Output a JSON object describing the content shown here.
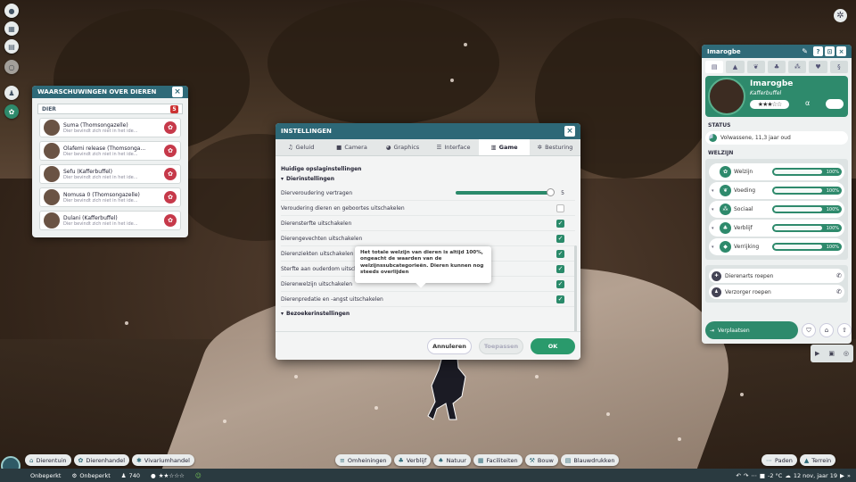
{
  "warnings_panel": {
    "title": "WAARSCHUWINGEN OVER DIEREN",
    "filter_label": "DIER",
    "filter_count": "5",
    "items": [
      {
        "name": "Suma (Thomsongazelle)",
        "message": "Dier bevindt zich niet in het ide..."
      },
      {
        "name": "Olafemi release (Thomsonga...",
        "message": "Dier bevindt zich niet in het ide..."
      },
      {
        "name": "Sefu (Kafferbuffel)",
        "message": "Dier bevindt zich niet in het ide..."
      },
      {
        "name": "Nomusa 0 (Thomsongazelle)",
        "message": "Dier bevindt zich niet in het ide..."
      },
      {
        "name": "Dulani (Kafferbuffel)",
        "message": "Dier bevindt zich niet in het ide..."
      }
    ]
  },
  "settings": {
    "title": "INSTELLINGEN",
    "tabs": [
      {
        "label": "Geluid",
        "icon": "music-icon"
      },
      {
        "label": "Camera",
        "icon": "camera-icon"
      },
      {
        "label": "Graphics",
        "icon": "palette-icon"
      },
      {
        "label": "Interface",
        "icon": "list-icon"
      },
      {
        "label": "Game",
        "icon": "chart-icon"
      },
      {
        "label": "Besturing",
        "icon": "gear-icon"
      }
    ],
    "active_tab": "Game",
    "section_title": "Huidige opslaginstellingen",
    "subsection_animals": "Dierinstellingen",
    "slider_row": {
      "label": "Dierveroudering vertragen",
      "value": "5",
      "fraction": 1.0
    },
    "rows": [
      {
        "label": "Veroudering dieren en geboortes uitschakelen",
        "checked": false
      },
      {
        "label": "Dierensterfte uitschakelen",
        "checked": true
      },
      {
        "label": "Dierengevechten uitschakelen",
        "checked": true
      },
      {
        "label": "Dierenziekten uitschakelen",
        "checked": true
      },
      {
        "label": "Sterfte aan ouderdom uitschakelen",
        "checked": true
      },
      {
        "label": "Dierenwelzijn uitschakelen",
        "checked": true
      },
      {
        "label": "Dierenpredatie en -angst uitschakelen",
        "checked": true
      }
    ],
    "subsection_visitors": "Bezoekerinstellingen",
    "tooltip": "Het totale welzijn van dieren is altijd 100%, ongeacht de waarden van de welzijnssubcategorieën. Dieren kunnen nog steeds overlijden",
    "buttons": {
      "cancel": "Annuleren",
      "apply": "Toepassen",
      "ok": "OK"
    }
  },
  "animal_panel": {
    "title": "Imarogbe",
    "name": "Imarogbe",
    "species": "Kafferbuffel",
    "rating_stars": 3,
    "rating_max": 5,
    "status_header": "STATUS",
    "status_text": "Volwassene, 11,3 jaar oud",
    "welfare_header": "WELZIJN",
    "welfare": [
      {
        "label": "Welzijn",
        "value": "100%",
        "level": 100
      },
      {
        "label": "Voeding",
        "value": "100%",
        "level": 100
      },
      {
        "label": "Sociaal",
        "value": "100%",
        "level": 100
      },
      {
        "label": "Verblijf",
        "value": "100%",
        "level": 100
      },
      {
        "label": "Verrijking",
        "value": "100%",
        "level": 100
      }
    ],
    "calls": [
      {
        "label": "Dierenarts roepen"
      },
      {
        "label": "Verzorger roepen"
      }
    ],
    "move_label": "Verplaatsen"
  },
  "bottom_bar": {
    "left_buttons": [
      "Dierentuin",
      "Dierenhandel",
      "Vivariumhandel"
    ],
    "center_buttons": [
      "Omheiningen",
      "Verblijf",
      "Natuur",
      "Faciliteiten",
      "Bouw",
      "Blauwdrukken"
    ],
    "right_buttons": [
      "Paden",
      "Terrein"
    ],
    "money_mode": "Onbeperkt",
    "research_mode": "Onbeperkt",
    "guests": "740",
    "temperature": "-2 °C",
    "date": "12 nov, jaar 19"
  },
  "colors": {
    "accent": "#2e8a6c",
    "titlebar": "#2f6a78",
    "alert": "#c6394a"
  }
}
